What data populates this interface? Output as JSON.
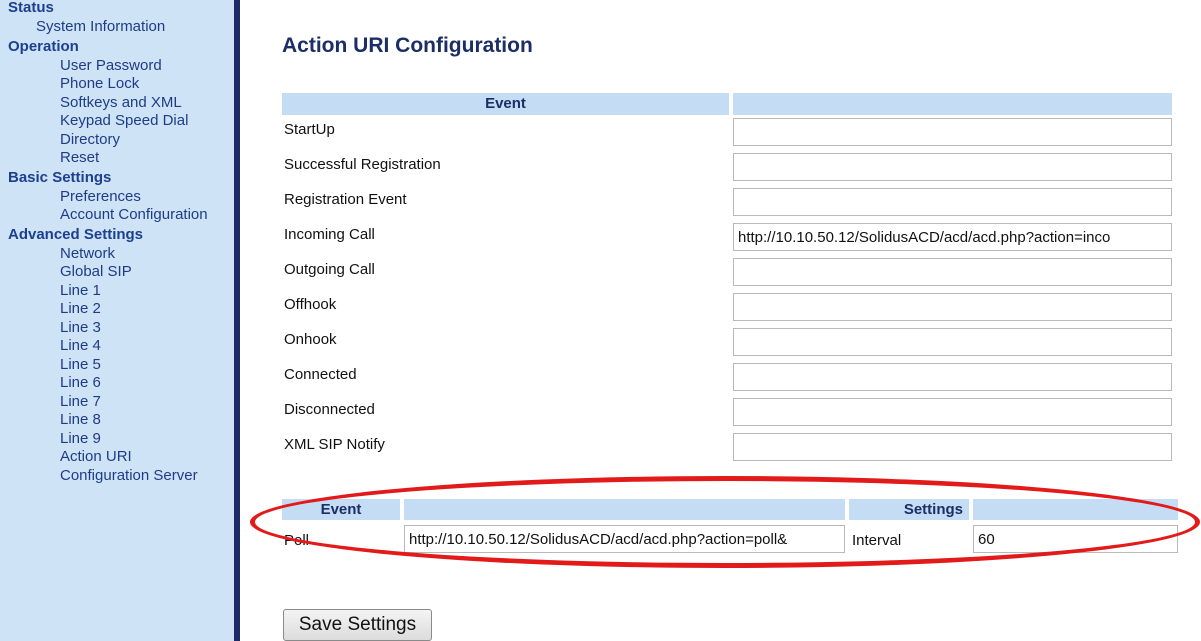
{
  "sidebar": {
    "sections": [
      {
        "label": "Status",
        "items": [
          "System Information"
        ]
      },
      {
        "label": "Operation",
        "items": [
          "User Password",
          "Phone Lock",
          "Softkeys and XML",
          "Keypad Speed Dial",
          "Directory",
          "Reset"
        ]
      },
      {
        "label": "Basic Settings",
        "items": [
          "Preferences",
          "Account Configuration"
        ]
      },
      {
        "label": "Advanced Settings",
        "items": [
          "Network",
          "Global SIP",
          "Line 1",
          "Line 2",
          "Line 3",
          "Line 4",
          "Line 5",
          "Line 6",
          "Line 7",
          "Line 8",
          "Line 9",
          "Action URI",
          "Configuration Server"
        ]
      }
    ]
  },
  "page": {
    "title": "Action URI Configuration"
  },
  "event_table": {
    "header": "Event",
    "rows": [
      {
        "label": "StartUp",
        "value": ""
      },
      {
        "label": "Successful Registration",
        "value": ""
      },
      {
        "label": "Registration Event",
        "value": ""
      },
      {
        "label": "Incoming Call",
        "value": "http://10.10.50.12/SolidusACD/acd/acd.php?action=inco"
      },
      {
        "label": "Outgoing Call",
        "value": ""
      },
      {
        "label": "Offhook",
        "value": ""
      },
      {
        "label": "Onhook",
        "value": ""
      },
      {
        "label": "Connected",
        "value": ""
      },
      {
        "label": "Disconnected",
        "value": ""
      },
      {
        "label": "XML SIP Notify",
        "value": ""
      }
    ]
  },
  "poll_table": {
    "event_header": "Event",
    "settings_header": "Settings",
    "label": "Poll",
    "uri_value": "http://10.10.50.12/SolidusACD/acd/acd.php?action=poll&",
    "interval_label": "Interval",
    "interval_value": "60"
  },
  "buttons": {
    "save": "Save Settings"
  },
  "colors": {
    "sidebar_bg": "#cfe3f6",
    "header_bg": "#c5ddf4",
    "highlight_ellipse": "#e21a1a",
    "nav_text": "#1e3c86"
  }
}
